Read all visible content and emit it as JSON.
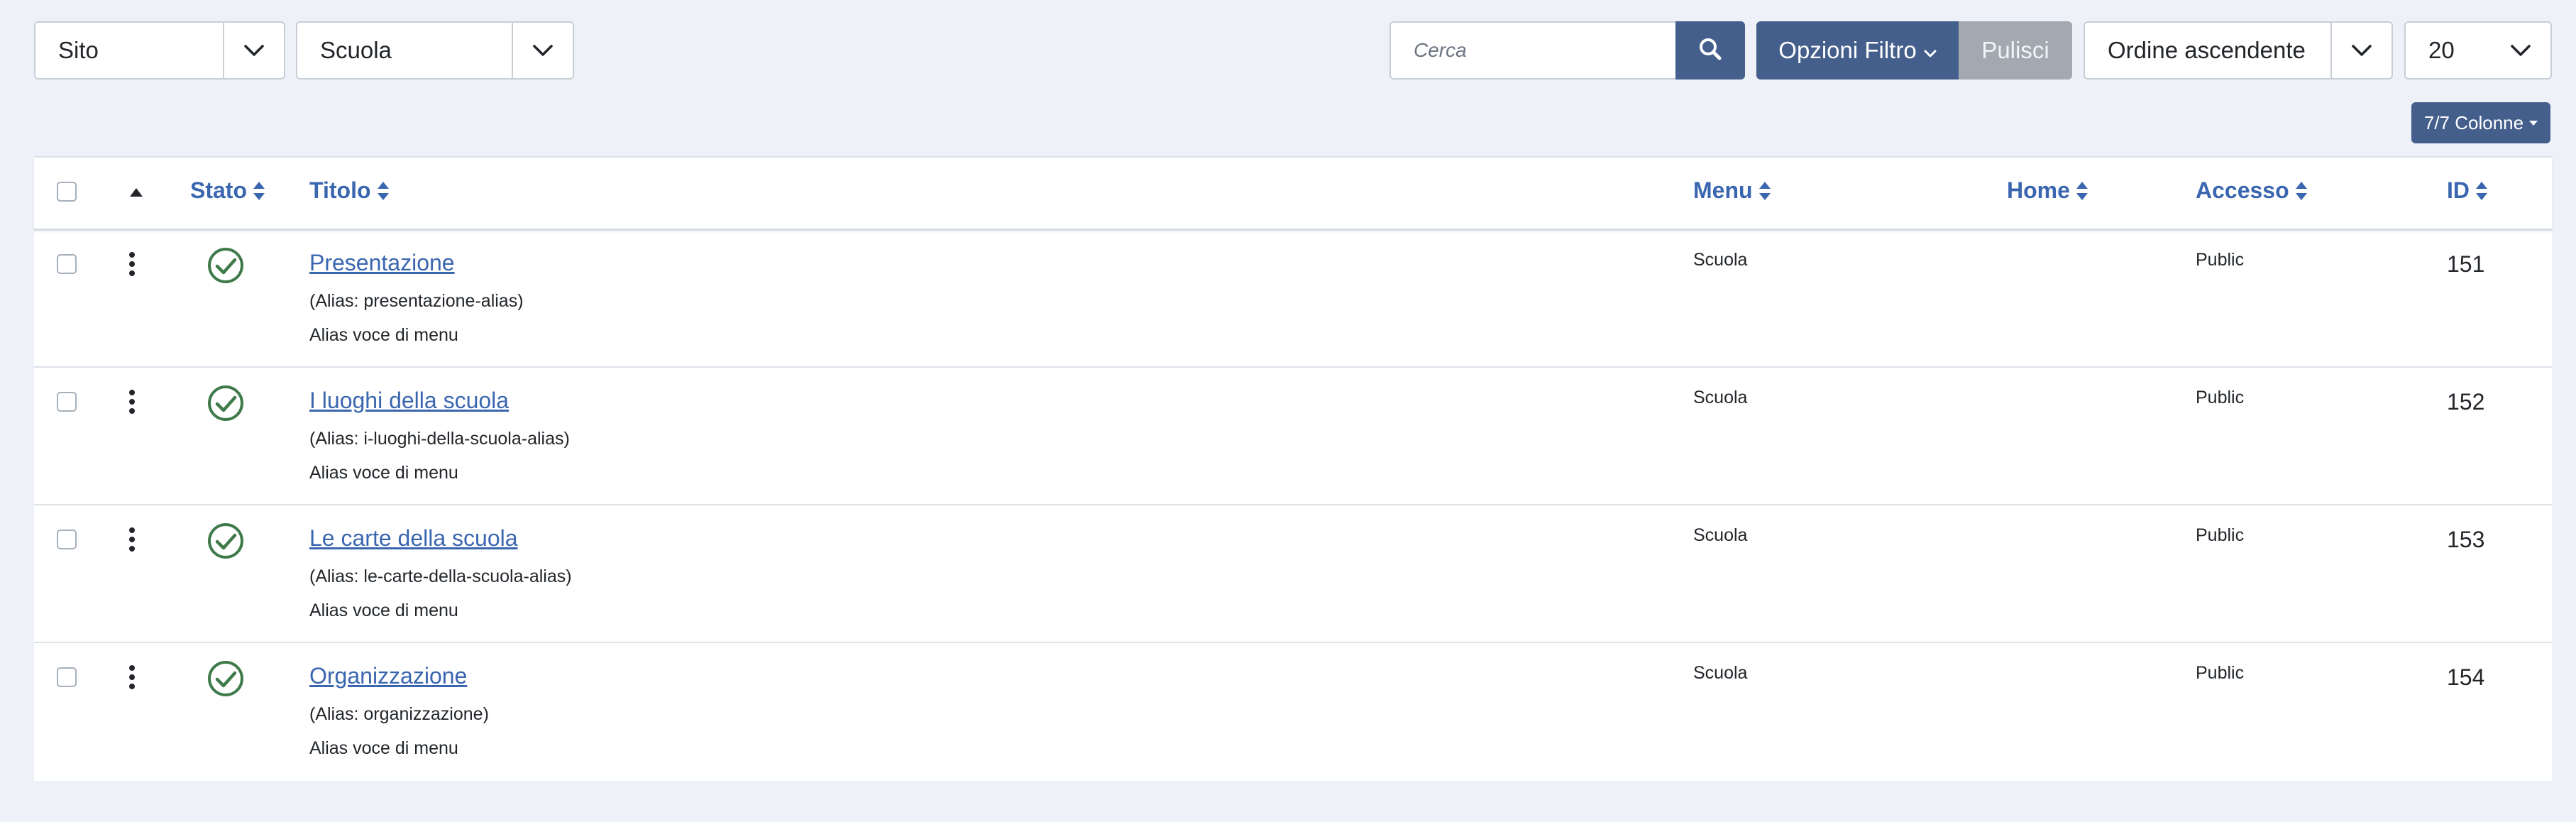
{
  "filters": {
    "site": "Sito",
    "menu": "Scuola",
    "search_placeholder": "Cerca",
    "filter_options": "Opzioni Filtro",
    "clear": "Pulisci",
    "ordering": "Ordine ascendente",
    "limit": "20"
  },
  "columns_button": "7/7 Colonne",
  "table": {
    "headers": {
      "status": "Stato",
      "title": "Titolo",
      "menu": "Menu",
      "home": "Home",
      "access": "Accesso",
      "id": "ID"
    },
    "rows": [
      {
        "title": "Presentazione",
        "alias": "(Alias: presentazione-alias)",
        "note": "Alias voce di menu",
        "menu": "Scuola",
        "access": "Public",
        "id": "151"
      },
      {
        "title": "I luoghi della scuola",
        "alias": "(Alias: i-luoghi-della-scuola-alias)",
        "note": "Alias voce di menu",
        "menu": "Scuola",
        "access": "Public",
        "id": "152"
      },
      {
        "title": "Le carte della scuola",
        "alias": "(Alias: le-carte-della-scuola-alias)",
        "note": "Alias voce di menu",
        "menu": "Scuola",
        "access": "Public",
        "id": "153"
      },
      {
        "title": "Organizzazione",
        "alias": "(Alias: organizzazione)",
        "note": "Alias voce di menu",
        "menu": "Scuola",
        "access": "Public",
        "id": "154"
      }
    ]
  },
  "colors": {
    "primary": "#445f8c",
    "link": "#3a66b0",
    "published": "#3f7a4a",
    "clear_button": "#a2a9b1",
    "background": "#eef2f8"
  }
}
